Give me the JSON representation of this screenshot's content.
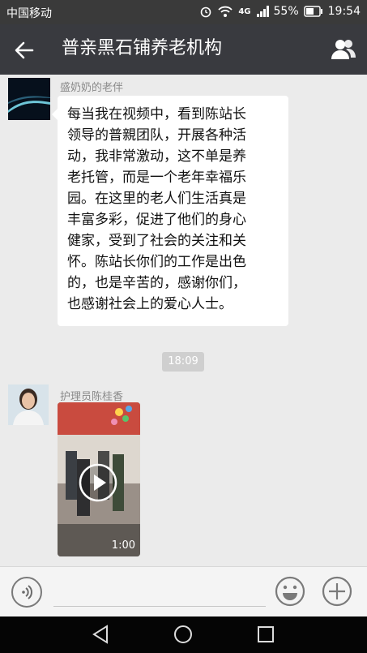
{
  "status_bar": {
    "carrier": "中国移动",
    "network": "4G",
    "battery": "55%",
    "time": "19:54"
  },
  "title_bar": {
    "title": "普亲黑石铺养老机构"
  },
  "messages": [
    {
      "sender": "盛奶奶的老伴",
      "lines": [
        "每当我在视频中，看到陈站长",
        "领导的普親团队，开展各种活",
        "动，我非常激动，这不单是养",
        "老托管，而是一个老年幸福乐",
        "园。在这里的老人们生活真是",
        "丰富多彩，促进了他们的身心",
        "健家，受到了社会的关注和关",
        "怀。陈站长你们的工作是出色",
        "的，也是辛苦的，感谢你们，",
        "也感谢社会上的爱心人士。"
      ]
    }
  ],
  "timestamp": "18:09",
  "video_message": {
    "sender": "护理员陈桂香",
    "duration": "1:00"
  },
  "colors": {
    "title_bar": "#393a3f",
    "chat_background": "#ebebeb",
    "bubble": "#ffffff"
  }
}
